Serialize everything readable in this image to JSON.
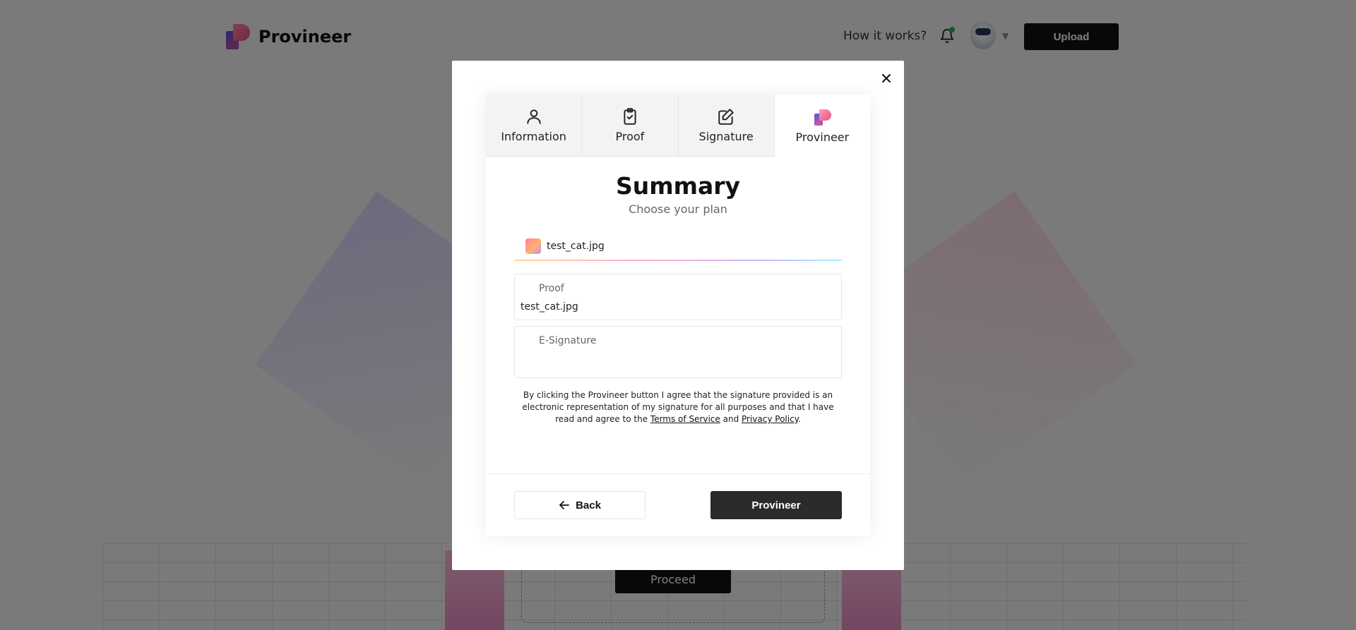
{
  "app": {
    "name": "Provineer"
  },
  "header": {
    "how_it_works": "How it works?",
    "upload_label": "Upload",
    "notification_status_color": "#1db954"
  },
  "background": {
    "proceed_label": "Proceed"
  },
  "modal": {
    "tabs": [
      {
        "label": "Information",
        "icon": "person-icon"
      },
      {
        "label": "Proof",
        "icon": "clipboard-check-icon"
      },
      {
        "label": "Signature",
        "icon": "edit-icon"
      },
      {
        "label": "Provineer",
        "icon": "provineer-logo-icon",
        "active": true
      }
    ],
    "title": "Summary",
    "subtitle": "Choose your plan",
    "file": {
      "name": "test_cat.jpg"
    },
    "proof_field": {
      "label": "Proof",
      "value": "test_cat.jpg"
    },
    "signature_field": {
      "label": "E-Signature",
      "value": ""
    },
    "consent": {
      "text_before": "By clicking the Provineer button I agree that the signature provided is an electronic representation of my signature for all purposes and that I have read and agree to the ",
      "terms": "Terms of Service",
      "and": " and ",
      "privacy": "Privacy Policy",
      "end": "."
    },
    "back_label": "Back",
    "submit_label": "Provineer"
  }
}
